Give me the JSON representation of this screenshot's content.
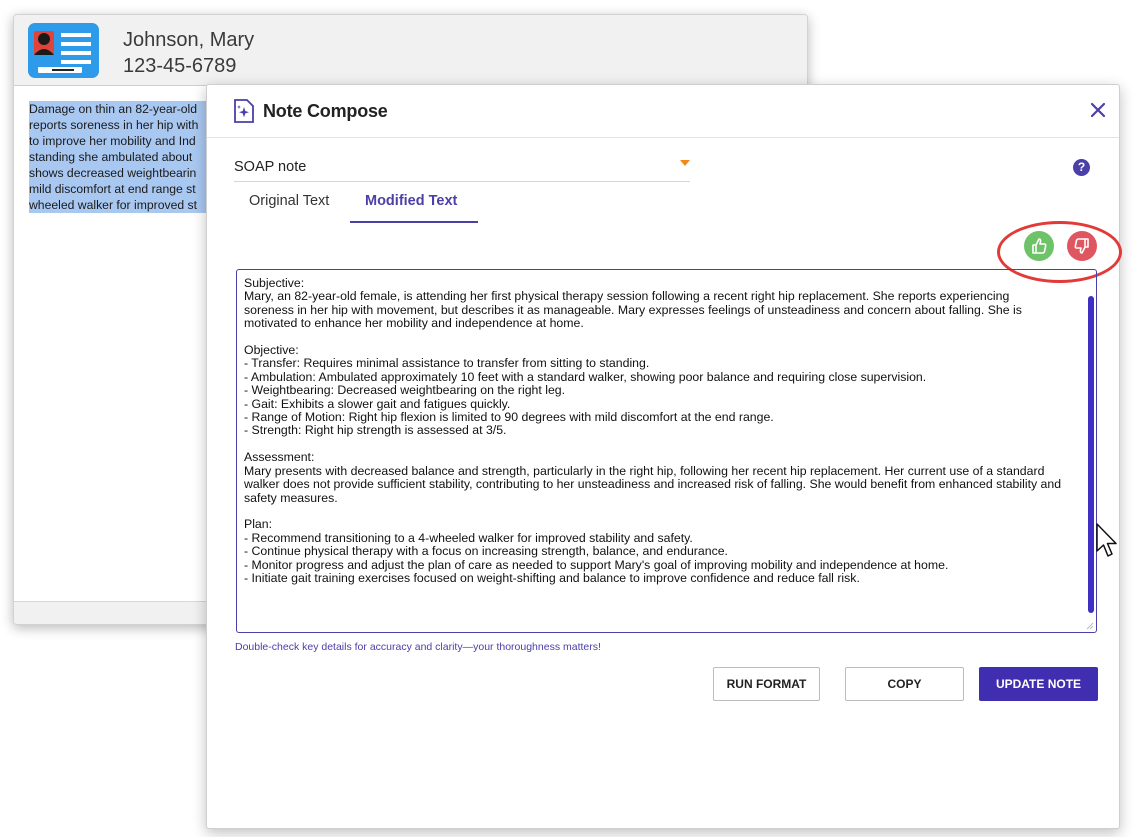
{
  "patient": {
    "name": "Johnson, Mary",
    "ssn": "123-45-6789",
    "original_lines": [
      "Damage on thin an 82-year-old",
      "reports soreness in her hip with",
      "to improve her mobility and Ind",
      "standing she ambulated about",
      "shows decreased weightbearin",
      "mild discomfort at end range st",
      "wheeled walker for improved st"
    ]
  },
  "compose": {
    "title": "Note Compose",
    "note_type": "SOAP note",
    "help_label": "?",
    "tabs": [
      {
        "label": "Original Text",
        "active": false
      },
      {
        "label": "Modified Text",
        "active": true
      }
    ],
    "note_text": "Subjective:\nMary, an 82-year-old female, is attending her first physical therapy session following a recent right hip replacement. She reports experiencing soreness in her hip with movement, but describes it as manageable. Mary expresses feelings of unsteadiness and concern about falling. She is motivated to enhance her mobility and independence at home.\n\nObjective:\n- Transfer: Requires minimal assistance to transfer from sitting to standing.\n- Ambulation: Ambulated approximately 10 feet with a standard walker, showing poor balance and requiring close supervision.\n- Weightbearing: Decreased weightbearing on the right leg.\n- Gait: Exhibits a slower gait and fatigues quickly.\n- Range of Motion: Right hip flexion is limited to 90 degrees with mild discomfort at the end range.\n- Strength: Right hip strength is assessed at 3/5.\n\nAssessment:\nMary presents with decreased balance and strength, particularly in the right hip, following her recent hip replacement. Her current use of a standard walker does not provide sufficient stability, contributing to her unsteadiness and increased risk of falling. She would benefit from enhanced stability and safety measures.\n\nPlan:\n- Recommend transitioning to a 4-wheeled walker for improved stability and safety.\n- Continue physical therapy with a focus on increasing strength, balance, and endurance.\n- Monitor progress and adjust the plan of care as needed to support Mary's goal of improving mobility and independence at home.\n- Initiate gait training exercises focused on weight-shifting and balance to improve confidence and reduce fall risk.",
    "hint": "Double-check key details for accuracy and clarity—your thoroughness matters!",
    "buttons": {
      "run_format": "RUN FORMAT",
      "copy": "COPY",
      "update_note": "UPDATE NOTE"
    }
  },
  "icons": {
    "patient_card": "id-card-icon",
    "compose": "sparkle-note-icon",
    "close": "close-icon",
    "dropdown": "caret-down-icon",
    "help": "help-icon",
    "thumbs_up": "thumbs-up-icon",
    "thumbs_down": "thumbs-down-icon",
    "cursor": "mouse-pointer-icon"
  },
  "colors": {
    "accent": "#4b3fa8",
    "primary_button": "#3f2fb0",
    "thumbs_up": "#6ec267",
    "thumbs_down": "#df5660",
    "highlight_ring": "#e23a36",
    "selection": "#a9c8f1",
    "patient_icon": "#2e9bea",
    "dropdown_arrow": "#f08a1c"
  }
}
